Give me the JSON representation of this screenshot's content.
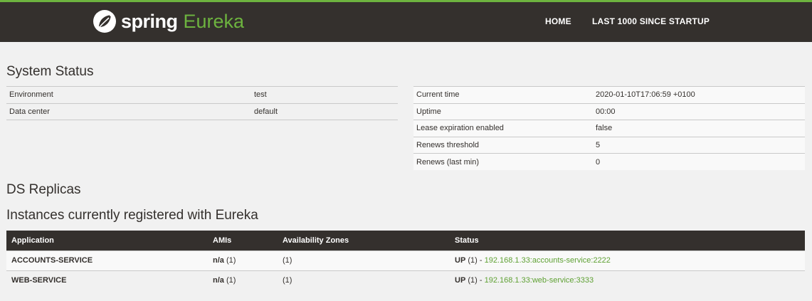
{
  "header": {
    "logo_spring": "spring",
    "logo_eureka": "Eureka",
    "nav": [
      "HOME",
      "LAST 1000 SINCE STARTUP"
    ],
    "accent_color": "#6db33f",
    "bar_color": "#34302d"
  },
  "system_status": {
    "title": "System Status",
    "left": [
      {
        "label": "Environment",
        "value": "test"
      },
      {
        "label": "Data center",
        "value": "default"
      }
    ],
    "right": [
      {
        "label": "Current time",
        "value": "2020-01-10T17:06:59 +0100"
      },
      {
        "label": "Uptime",
        "value": "00:00"
      },
      {
        "label": "Lease expiration enabled",
        "value": "false"
      },
      {
        "label": "Renews threshold",
        "value": "5"
      },
      {
        "label": "Renews (last min)",
        "value": "0"
      }
    ]
  },
  "ds_replicas": {
    "title": "DS Replicas"
  },
  "instances": {
    "title": "Instances currently registered with Eureka",
    "headers": [
      "Application",
      "AMIs",
      "Availability Zones",
      "Status"
    ],
    "rows": [
      {
        "application": "ACCOUNTS-SERVICE",
        "ami_bold": "n/a",
        "ami_count": "(1)",
        "zones": "(1)",
        "status_bold": "UP",
        "status_count": "(1) - ",
        "status_link": "192.168.1.33:accounts-service:2222"
      },
      {
        "application": "WEB-SERVICE",
        "ami_bold": "n/a",
        "ami_count": "(1)",
        "zones": "(1)",
        "status_bold": "UP",
        "status_count": "(1) - ",
        "status_link": "192.168.1.33:web-service:3333"
      }
    ]
  }
}
